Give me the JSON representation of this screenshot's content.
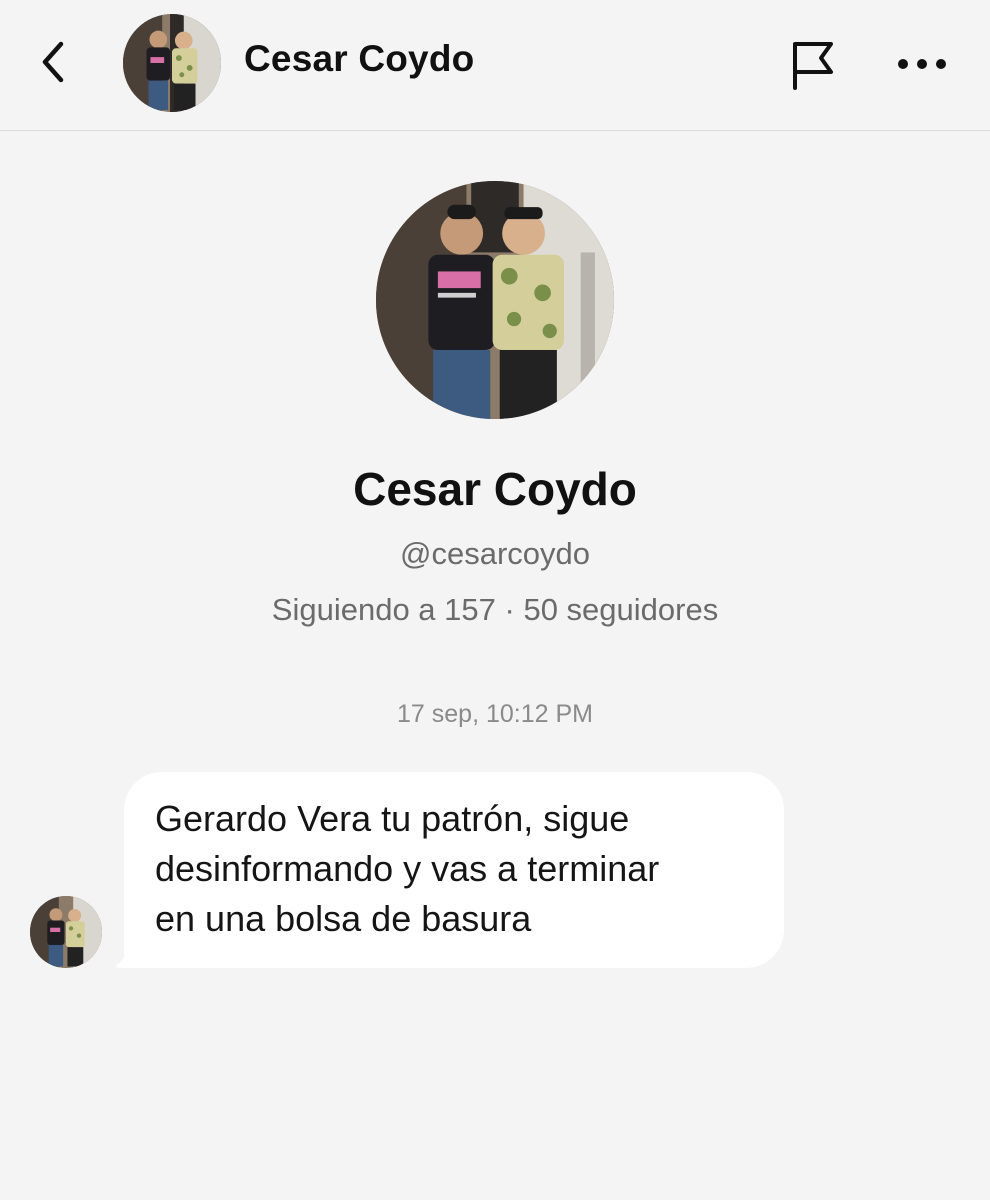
{
  "header": {
    "back_icon": "chevron-left-icon",
    "name": "Cesar Coydo",
    "flag_icon": "flag-icon",
    "more_icon": "more-horizontal-icon"
  },
  "profile": {
    "name": "Cesar Coydo",
    "handle": "@cesarcoydo",
    "following": "Siguiendo a 157",
    "separator": " · ",
    "followers": "50 seguidores"
  },
  "conversation": {
    "timestamp": "17 sep, 10:12 PM",
    "messages": [
      {
        "text": "Gerardo Vera tu patrón, sigue\ndesinformando y vas a terminar\nen una bolsa de basura"
      }
    ]
  },
  "colors": {
    "background": "#f4f4f4",
    "bubble": "#ffffff",
    "secondary_text": "#6b6b6b"
  }
}
